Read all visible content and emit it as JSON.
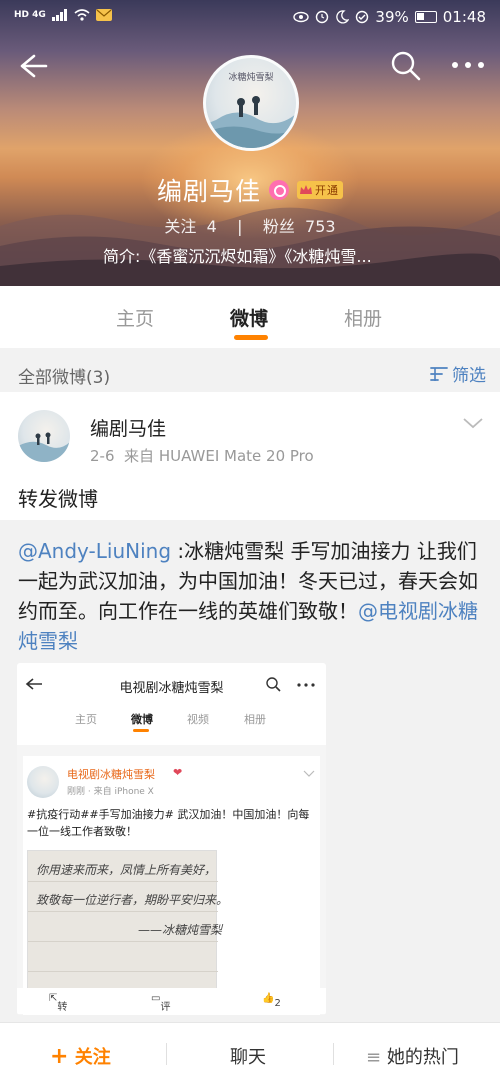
{
  "status_bar": {
    "network": "HD 4G",
    "battery": "39%",
    "time": "01:48"
  },
  "profile": {
    "name": "编剧马佳",
    "vip_label": "开通",
    "follow_label": "关注",
    "follow_count": "4",
    "fans_label": "粉丝",
    "fans_count": "753",
    "bio": "简介:《香蜜沉沉烬如霜》《冰糖炖雪..."
  },
  "tabs": [
    {
      "label": "主页"
    },
    {
      "label": "微博"
    },
    {
      "label": "相册"
    }
  ],
  "filter": {
    "label": "全部微博(3)",
    "button": "筛选"
  },
  "post": {
    "author": "编剧马佳",
    "date": "2-6",
    "source": "来自 HUAWEI Mate 20 Pro",
    "text": "转发微博"
  },
  "repost": {
    "mention": "@Andy-LiuNing",
    "body": " :冰糖炖雪梨 手写加油接力 让我们一起为武汉加油，为中国加油！冬天已过，春天会如约而至。向工作在一线的英雄们致敬！",
    "link": "@电视剧冰糖炖雪梨"
  },
  "embedded": {
    "title": "电视剧冰糖炖雪梨",
    "tabs": [
      "主页",
      "微博",
      "视频",
      "相册"
    ],
    "name": "电视剧冰糖炖雪梨",
    "meta": "刚刚 · 来自 iPhone X",
    "text": "#抗疫行动##手写加油接力# 武汉加油！中国加油！向每一位一线工作者致敬！",
    "handwriting": [
      "你用速来而来，凤情上所有美好，",
      "致敬每一位逆行者，期盼平安归来。",
      "——冰糖炖雪梨"
    ],
    "footer": {
      "repost": "转发",
      "comment": "评论",
      "like": "2"
    }
  },
  "bottom_bar": {
    "follow": "关注",
    "chat": "聊天",
    "hot": "她的热门"
  }
}
